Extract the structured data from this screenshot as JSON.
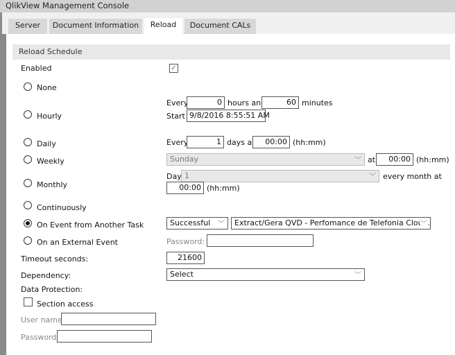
{
  "window_title": "QlikView Management Console",
  "tabs": [
    "Server",
    "Document Information",
    "Reload",
    "Document CALs"
  ],
  "section_title": "Reload Schedule",
  "enabled_label": "Enabled",
  "enabled_check": "✓",
  "options": {
    "none": "None",
    "hourly": "Hourly",
    "daily": "Daily",
    "weekly": "Weekly",
    "monthly": "Monthly",
    "continuously": "Continuously",
    "on_event": "On Event from Another Task",
    "external": "On an External Event"
  },
  "hourly": {
    "every": "Every",
    "hours": "0",
    "hours_and": "hours and",
    "minutes": "60",
    "minutes_label": "minutes",
    "start": "Start",
    "start_value": "9/8/2016 8:55:51 AM"
  },
  "daily": {
    "every": "Every",
    "days": "1",
    "days_at": "days at",
    "time": "00:00",
    "fmt": "(hh:mm)"
  },
  "weekly": {
    "day": "Sunday",
    "at": "at",
    "time": "00:00",
    "fmt": "(hh:mm)"
  },
  "monthly": {
    "day_label": "Day",
    "day": "1",
    "every_month": "every month at",
    "time": "00:00",
    "fmt": "(hh:mm)"
  },
  "on_event": {
    "status": "Successful",
    "task": "Extract/Gera QVD - Perfomance de Telefonia Cloud.qvw"
  },
  "external": {
    "password_label": "Password:",
    "password": ""
  },
  "timeout": {
    "label": "Timeout seconds:",
    "value": "21600"
  },
  "dependency": {
    "label": "Dependency:",
    "value": "Select"
  },
  "data_protection": {
    "label": "Data Protection:",
    "section_access": "Section access",
    "user_label": "User name:",
    "password_label": "Password:"
  }
}
